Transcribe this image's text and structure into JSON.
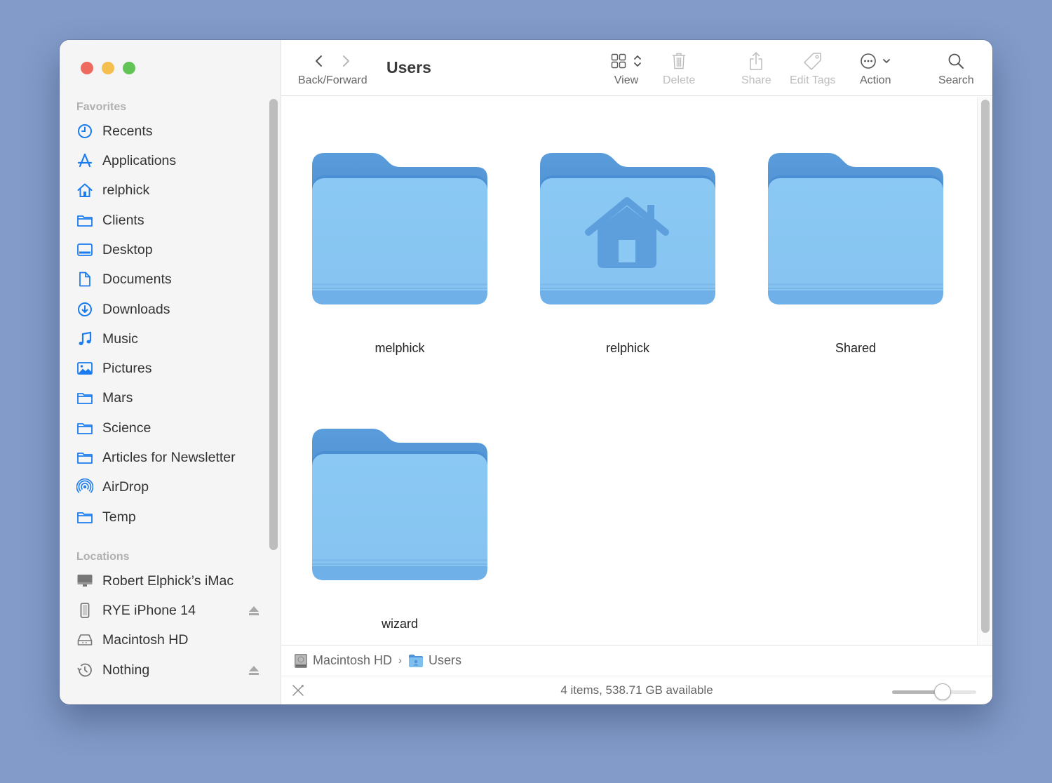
{
  "window": {
    "title": "Users"
  },
  "sidebar": {
    "favorites_label": "Favorites",
    "favorites": [
      {
        "label": "Recents",
        "icon": "clock-icon"
      },
      {
        "label": "Applications",
        "icon": "app-store-icon"
      },
      {
        "label": "relphick",
        "icon": "home-icon"
      },
      {
        "label": "Clients",
        "icon": "folder-icon"
      },
      {
        "label": "Desktop",
        "icon": "desktop-icon"
      },
      {
        "label": "Documents",
        "icon": "document-icon"
      },
      {
        "label": "Downloads",
        "icon": "download-icon"
      },
      {
        "label": "Music",
        "icon": "music-note-icon"
      },
      {
        "label": "Pictures",
        "icon": "photo-icon"
      },
      {
        "label": "Mars",
        "icon": "folder-icon"
      },
      {
        "label": "Science",
        "icon": "folder-icon"
      },
      {
        "label": "Articles for Newsletter",
        "icon": "folder-icon"
      },
      {
        "label": "AirDrop",
        "icon": "airdrop-icon"
      },
      {
        "label": "Temp",
        "icon": "folder-icon"
      }
    ],
    "locations_label": "Locations",
    "locations": [
      {
        "label": "Robert Elphick’s iMac",
        "icon": "imac-icon",
        "ejectable": false
      },
      {
        "label": "RYE iPhone 14",
        "icon": "iphone-icon",
        "ejectable": true
      },
      {
        "label": "Macintosh HD",
        "icon": "hard-drive-icon",
        "ejectable": false
      },
      {
        "label": "Nothing",
        "icon": "time-machine-icon",
        "ejectable": true
      }
    ]
  },
  "toolbar": {
    "back_forward_label": "Back/Forward",
    "view_label": "View",
    "delete_label": "Delete",
    "share_label": "Share",
    "edit_tags_label": "Edit Tags",
    "action_label": "Action",
    "search_label": "Search"
  },
  "content": {
    "items": [
      {
        "name": "melphick",
        "type": "folder"
      },
      {
        "name": "relphick",
        "type": "home-folder"
      },
      {
        "name": "Shared",
        "type": "folder"
      },
      {
        "name": "wizard",
        "type": "folder"
      }
    ]
  },
  "pathbar": {
    "segments": [
      "Macintosh HD",
      "Users"
    ],
    "separator": "›"
  },
  "statusbar": {
    "text": "4 items, 538.71 GB available",
    "icon_size_fraction": 0.6
  },
  "colors": {
    "accent": "#1a7cf0",
    "folder_back": "#5fa2de",
    "folder_front": "#8ccaf5"
  }
}
